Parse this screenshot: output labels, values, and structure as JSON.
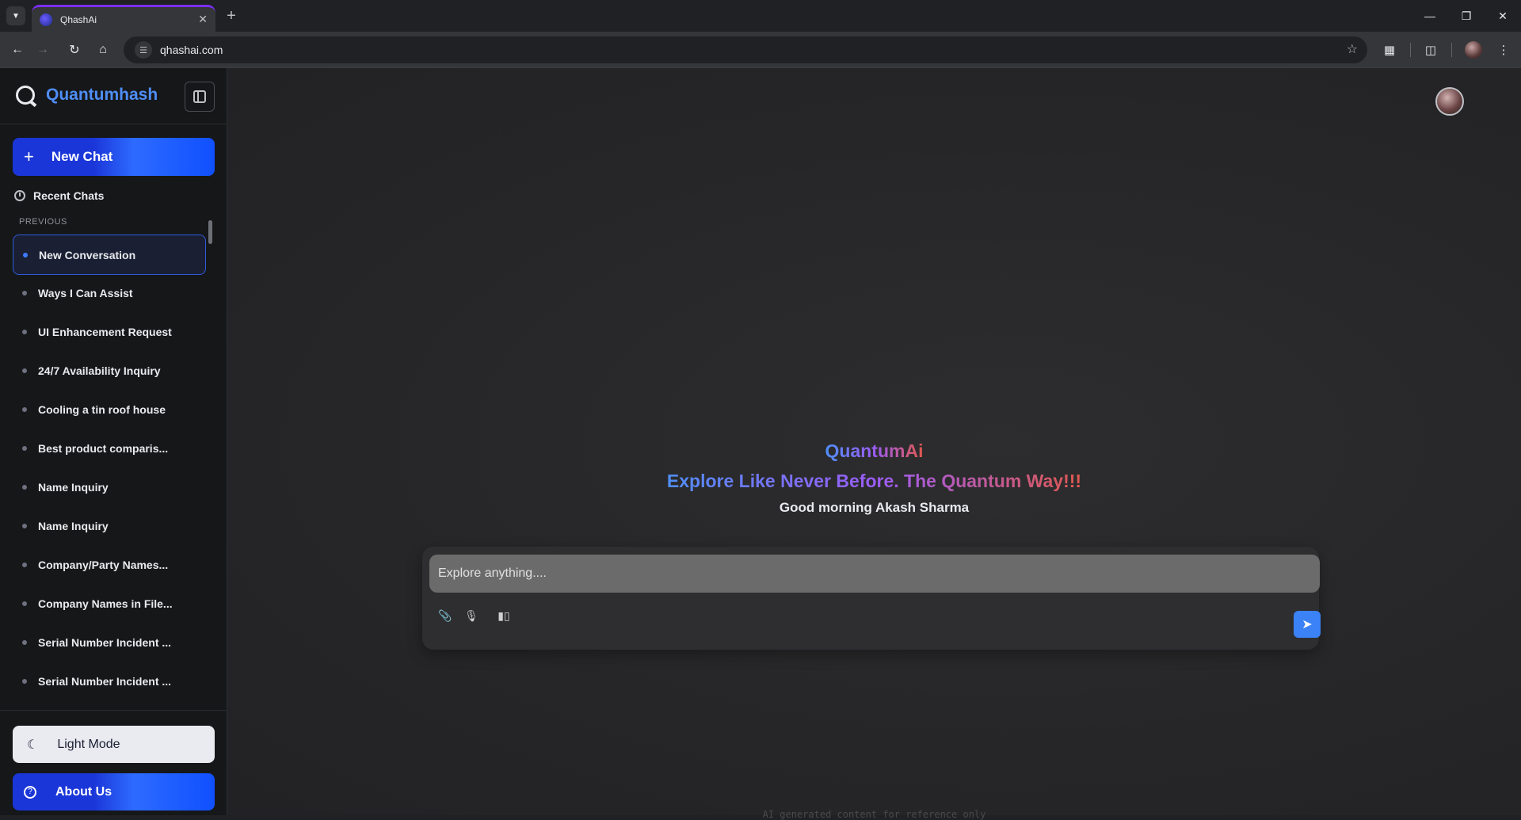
{
  "browser": {
    "tab_title": "QhashAi",
    "url": "qhashai.com",
    "new_tab_icon": "plus-icon",
    "window_controls": [
      "minimize-icon",
      "restore-icon",
      "close-icon"
    ]
  },
  "sidebar": {
    "brand": "Quantumhash",
    "new_chat_label": "New Chat",
    "recent_label": "Recent Chats",
    "section_label": "PREVIOUS",
    "chats": [
      "New Conversation",
      "Ways I Can Assist",
      "UI Enhancement Request",
      "24/7 Availability Inquiry",
      "Cooling a tin roof house",
      "Best product comparis...",
      "Name Inquiry",
      "Name Inquiry",
      "Company/Party Names...",
      "Company Names in File...",
      "Serial Number Incident ...",
      "Serial Number Incident ..."
    ],
    "active_index": 0,
    "light_mode_label": "Light Mode",
    "about_label": "About Us"
  },
  "main": {
    "title": "QuantumAi",
    "tagline": "Explore Like Never Before. The Quantum Way!!!",
    "greeting": "Good morning Akash Sharma",
    "input_placeholder": "Explore anything....",
    "footer_note": "AI generated content for reference only"
  },
  "colors": {
    "accent": "#4f8ef7",
    "button_blue": "#1b36d8",
    "send_blue": "#3b82f6"
  }
}
